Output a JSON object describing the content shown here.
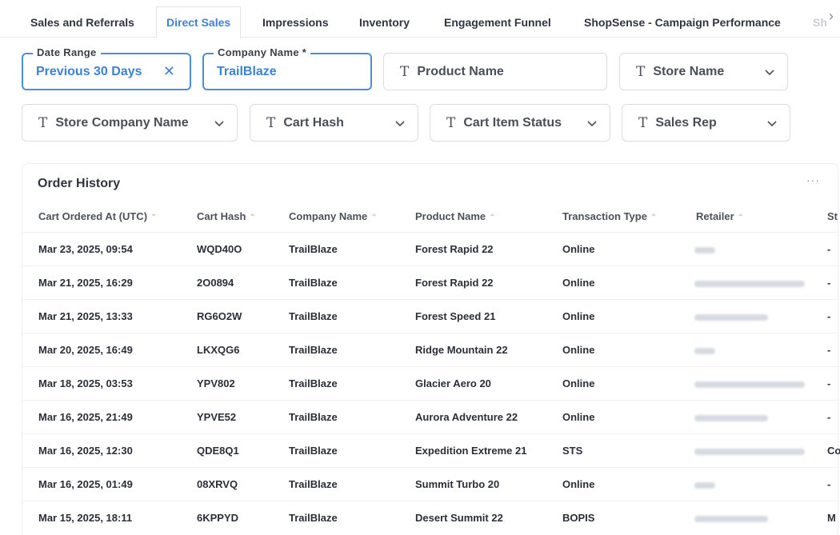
{
  "tabs": [
    {
      "label": "Sales and Referrals",
      "active": false
    },
    {
      "label": "Direct Sales",
      "active": true
    },
    {
      "label": "Impressions",
      "active": false
    },
    {
      "label": "Inventory",
      "active": false
    },
    {
      "label": "Engagement Funnel",
      "active": false
    },
    {
      "label": "ShopSense - Campaign Performance",
      "active": false
    },
    {
      "label": "Sh",
      "active": false
    }
  ],
  "filters": {
    "date_range": {
      "legend": "Date Range",
      "value": "Previous 30 Days"
    },
    "company_name": {
      "legend": "Company Name *",
      "value": "TrailBlaze"
    },
    "product_name": {
      "label": "Product Name"
    },
    "store_name": {
      "label": "Store Name"
    },
    "store_company_name": {
      "label": "Store Company Name"
    },
    "cart_hash": {
      "label": "Cart Hash"
    },
    "cart_item_status": {
      "label": "Cart Item Status"
    },
    "sales_rep": {
      "label": "Sales Rep"
    }
  },
  "table": {
    "title": "Order History",
    "more": "···",
    "columns": [
      "Cart Ordered At (UTC)",
      "Cart Hash",
      "Company Name",
      "Product Name",
      "Transaction Type",
      "Retailer",
      "St"
    ],
    "rows": [
      [
        "Mar 23, 2025, 09:54",
        "WQD40O",
        "TrailBlaze",
        "Forest Rapid 22",
        "Online",
        "-"
      ],
      [
        "Mar 21, 2025, 16:29",
        "2O0894",
        "TrailBlaze",
        "Forest Rapid 22",
        "Online",
        "-"
      ],
      [
        "Mar 21, 2025, 13:33",
        "RG6O2W",
        "TrailBlaze",
        "Forest Speed 21",
        "Online",
        "-"
      ],
      [
        "Mar 20, 2025, 16:49",
        "LKXQG6",
        "TrailBlaze",
        "Ridge Mountain 22",
        "Online",
        "-"
      ],
      [
        "Mar 18, 2025, 03:53",
        "YPV802",
        "TrailBlaze",
        "Glacier Aero 20",
        "Online",
        "-"
      ],
      [
        "Mar 16, 2025, 21:49",
        "YPVE52",
        "TrailBlaze",
        "Aurora Adventure 22",
        "Online",
        "-"
      ],
      [
        "Mar 16, 2025, 12:30",
        "QDE8Q1",
        "TrailBlaze",
        "Expedition Extreme 21",
        "STS",
        "Co"
      ],
      [
        "Mar 16, 2025, 01:49",
        "08XRVQ",
        "TrailBlaze",
        "Summit Turbo 20",
        "Online",
        "-"
      ],
      [
        "Mar 15, 2025, 18:11",
        "6KPPYD",
        "TrailBlaze",
        "Desert Summit 22",
        "BOPIS",
        "M"
      ]
    ]
  },
  "colors": {
    "accent": "#3b82d8",
    "border": "#d9dce1"
  }
}
